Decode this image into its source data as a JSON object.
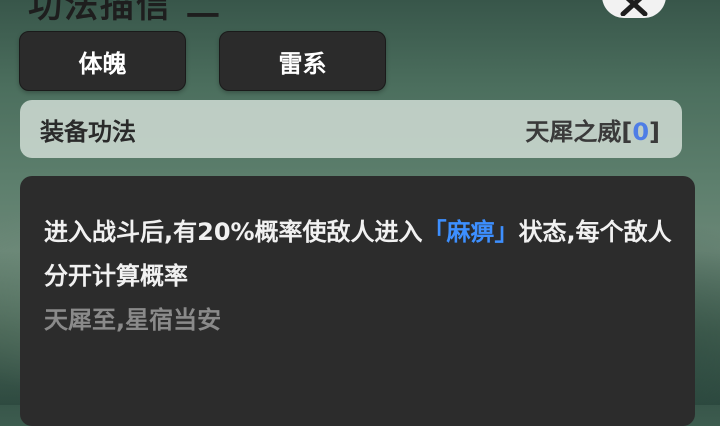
{
  "header": {
    "title": "功法描信 二"
  },
  "tags": [
    {
      "label": "体魄"
    },
    {
      "label": "雷系"
    }
  ],
  "equip": {
    "label": "装备功法",
    "name": "天犀之威",
    "bracket_open": "[",
    "count": "0",
    "bracket_close": "]"
  },
  "description": {
    "text_before": "进入战斗后,有20%概率使敌人进入",
    "keyword": "「麻痹」",
    "text_after": "状态,每个敌人分开计算概率",
    "flavor": "天犀至,星宿当安"
  },
  "colors": {
    "keyword": "#3d8fff",
    "count": "#4e7de6",
    "panel": "#2c2c2c",
    "tag": "#2b2b2b"
  },
  "icons": {
    "close": "close-icon"
  }
}
